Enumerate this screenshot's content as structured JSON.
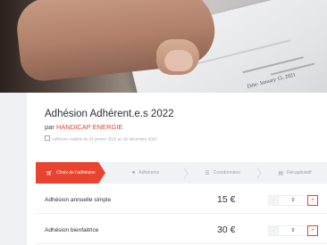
{
  "hero": {
    "date_text": "Date: January 15, 2021"
  },
  "event": {
    "title": "Adhésion Adhérent.e.s 2022",
    "organizer_prefix": "par",
    "organizer_name": "HANDICAP ENERGIE",
    "validity": "Adhésion valable du 01 janvier 2022 au 30 décembre 2022"
  },
  "steps": [
    {
      "label": "Choix de l'adhésion",
      "icon": "cart-icon"
    },
    {
      "label": "Adhérents",
      "icon": "user-icon"
    },
    {
      "label": "Coordonnées",
      "icon": "list-icon"
    },
    {
      "label": "Récapitulatif",
      "icon": "receipt-icon"
    }
  ],
  "items": [
    {
      "label": "Adhésion annuelle simple",
      "price": "15 €",
      "qty": "0",
      "minus": "-",
      "plus": "+"
    },
    {
      "label": "Adhésion bienfaitrice",
      "price": "30 €",
      "qty": "0",
      "minus": "-",
      "plus": "+"
    }
  ],
  "colors": {
    "accent": "#e8442f",
    "text": "#2b2f3a",
    "muted": "#a3a7b0",
    "background": "#eef0f3"
  }
}
